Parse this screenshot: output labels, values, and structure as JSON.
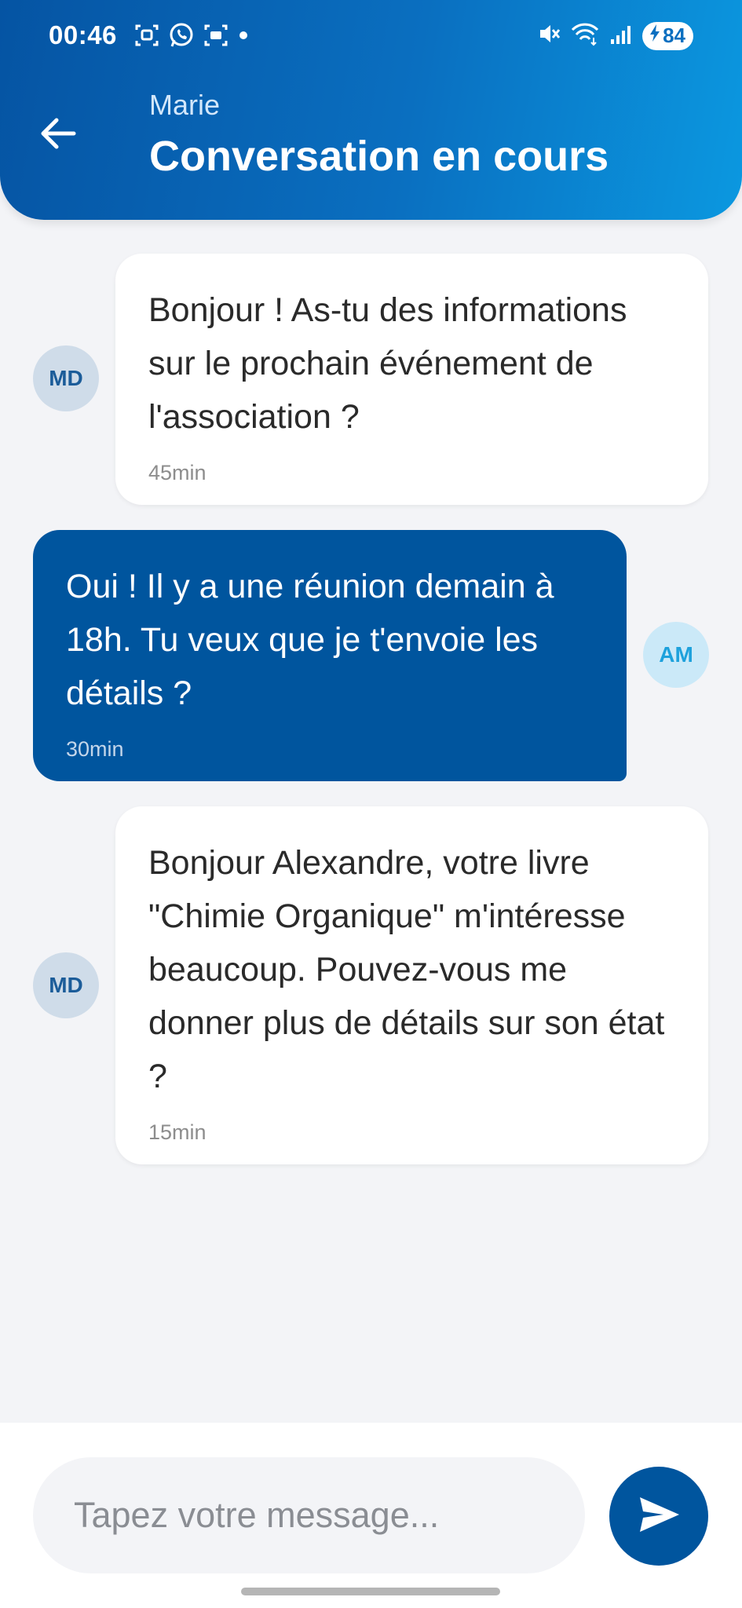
{
  "status_bar": {
    "time": "00:46",
    "battery": "84",
    "icons_left": [
      "screenshot-icon",
      "whatsapp-icon",
      "screen-record-icon",
      "dot-icon"
    ],
    "icons_right": [
      "mute-icon",
      "wifi-icon",
      "signal-icon",
      "battery-charging-icon"
    ]
  },
  "header": {
    "contact_name": "Marie",
    "title": "Conversation en cours",
    "back_icon": "arrow-left-icon",
    "gradient_start": "#0554a3",
    "gradient_end": "#0b98e0"
  },
  "messages": [
    {
      "direction": "incoming",
      "avatar": "MD",
      "text": "Bonjour ! As-tu des informations sur le prochain événement de l'association ?",
      "time": "45min"
    },
    {
      "direction": "outgoing",
      "avatar": "AM",
      "text": "Oui ! Il y a une réunion demain à 18h. Tu veux que je t'envoie les détails ?",
      "time": "30min"
    },
    {
      "direction": "incoming",
      "avatar": "MD",
      "text": "Bonjour Alexandre, votre livre \"Chimie Organique\" m'intéresse beaucoup. Pouvez-vous me donner plus de détails sur son état ?",
      "time": "15min"
    }
  ],
  "composer": {
    "placeholder": "Tapez votre message...",
    "value": "",
    "send_icon": "send-icon"
  },
  "colors": {
    "primary": "#00559e",
    "background": "#f3f4f7",
    "incoming_bubble": "#ffffff",
    "md_avatar_bg": "#cfdce9",
    "am_avatar_bg": "#cbe9f8"
  }
}
